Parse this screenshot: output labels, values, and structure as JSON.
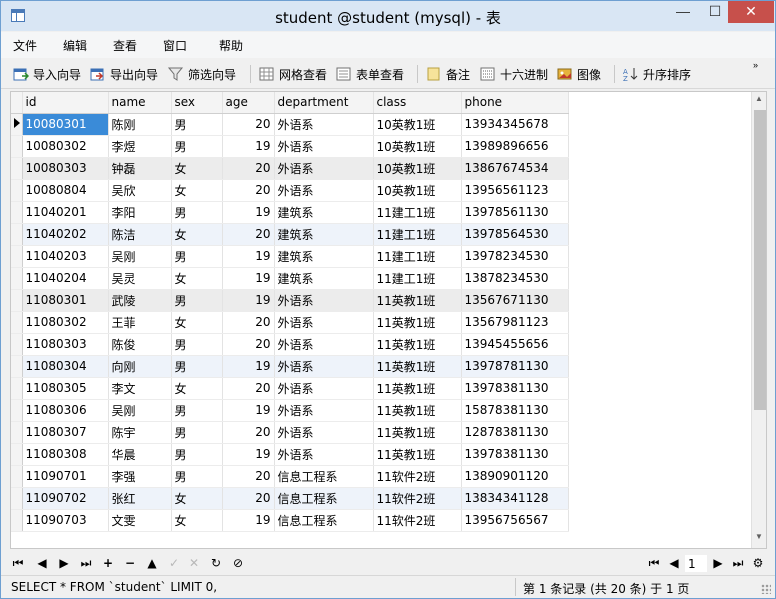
{
  "window": {
    "title": "student @student (mysql) - 表",
    "min_glyph": "—",
    "max_glyph": "☐",
    "close_glyph": "✕"
  },
  "menu": {
    "items": [
      "文件",
      "编辑",
      "查看",
      "窗口",
      "帮助"
    ]
  },
  "toolbar": {
    "import_wizard": "导入向导",
    "export_wizard": "导出向导",
    "filter_wizard": "筛选向导",
    "grid_view": "网格查看",
    "form_view": "表单查看",
    "memo": "备注",
    "hex": "十六进制",
    "image": "图像",
    "sort_asc": "升序排序",
    "overflow": "»"
  },
  "grid": {
    "columns": [
      "id",
      "name",
      "sex",
      "age",
      "department",
      "class",
      "phone"
    ],
    "rows": [
      [
        "10080301",
        "陈刚",
        "男",
        "20",
        "外语系",
        "10英教1班",
        "13934345678"
      ],
      [
        "10080302",
        "李煜",
        "男",
        "19",
        "外语系",
        "10英教1班",
        "13989896656"
      ],
      [
        "10080303",
        "钟磊",
        "女",
        "20",
        "外语系",
        "10英教1班",
        "13867674534"
      ],
      [
        "10080804",
        "吴欣",
        "女",
        "20",
        "外语系",
        "10英教1班",
        "13956561123"
      ],
      [
        "11040201",
        "李阳",
        "男",
        "19",
        "建筑系",
        "11建工1班",
        "13978561130"
      ],
      [
        "11040202",
        "陈洁",
        "女",
        "20",
        "建筑系",
        "11建工1班",
        "13978564530"
      ],
      [
        "11040203",
        "吴刚",
        "男",
        "19",
        "建筑系",
        "11建工1班",
        "13978234530"
      ],
      [
        "11040204",
        "吴灵",
        "女",
        "19",
        "建筑系",
        "11建工1班",
        "13878234530"
      ],
      [
        "11080301",
        "武陵",
        "男",
        "19",
        "外语系",
        "11英教1班",
        "13567671130"
      ],
      [
        "11080302",
        "王菲",
        "女",
        "20",
        "外语系",
        "11英教1班",
        "13567981123"
      ],
      [
        "11080303",
        "陈俊",
        "男",
        "20",
        "外语系",
        "11英教1班",
        "13945455656"
      ],
      [
        "11080304",
        "向刚",
        "男",
        "19",
        "外语系",
        "11英教1班",
        "13978781130"
      ],
      [
        "11080305",
        "李文",
        "女",
        "20",
        "外语系",
        "11英教1班",
        "13978381130"
      ],
      [
        "11080306",
        "吴刚",
        "男",
        "19",
        "外语系",
        "11英教1班",
        "15878381130"
      ],
      [
        "11080307",
        "陈宇",
        "男",
        "20",
        "外语系",
        "11英教1班",
        "12878381130"
      ],
      [
        "11080308",
        "华晨",
        "男",
        "19",
        "外语系",
        "11英教1班",
        "13978381130"
      ],
      [
        "11090701",
        "李强",
        "男",
        "20",
        "信息工程系",
        "11软件2班",
        "13890901120"
      ],
      [
        "11090702",
        "张红",
        "女",
        "20",
        "信息工程系",
        "11软件2班",
        "13834341128"
      ],
      [
        "11090703",
        "文雯",
        "女",
        "19",
        "信息工程系",
        "11软件2班",
        "13956756567"
      ]
    ],
    "selected_row": 0
  },
  "navigation": {
    "page_value": "1"
  },
  "status": {
    "sql": "SELECT * FROM `student` LIMIT 0,",
    "record_info": "第 1 条记录 (共 20 条) 于 1 页"
  }
}
